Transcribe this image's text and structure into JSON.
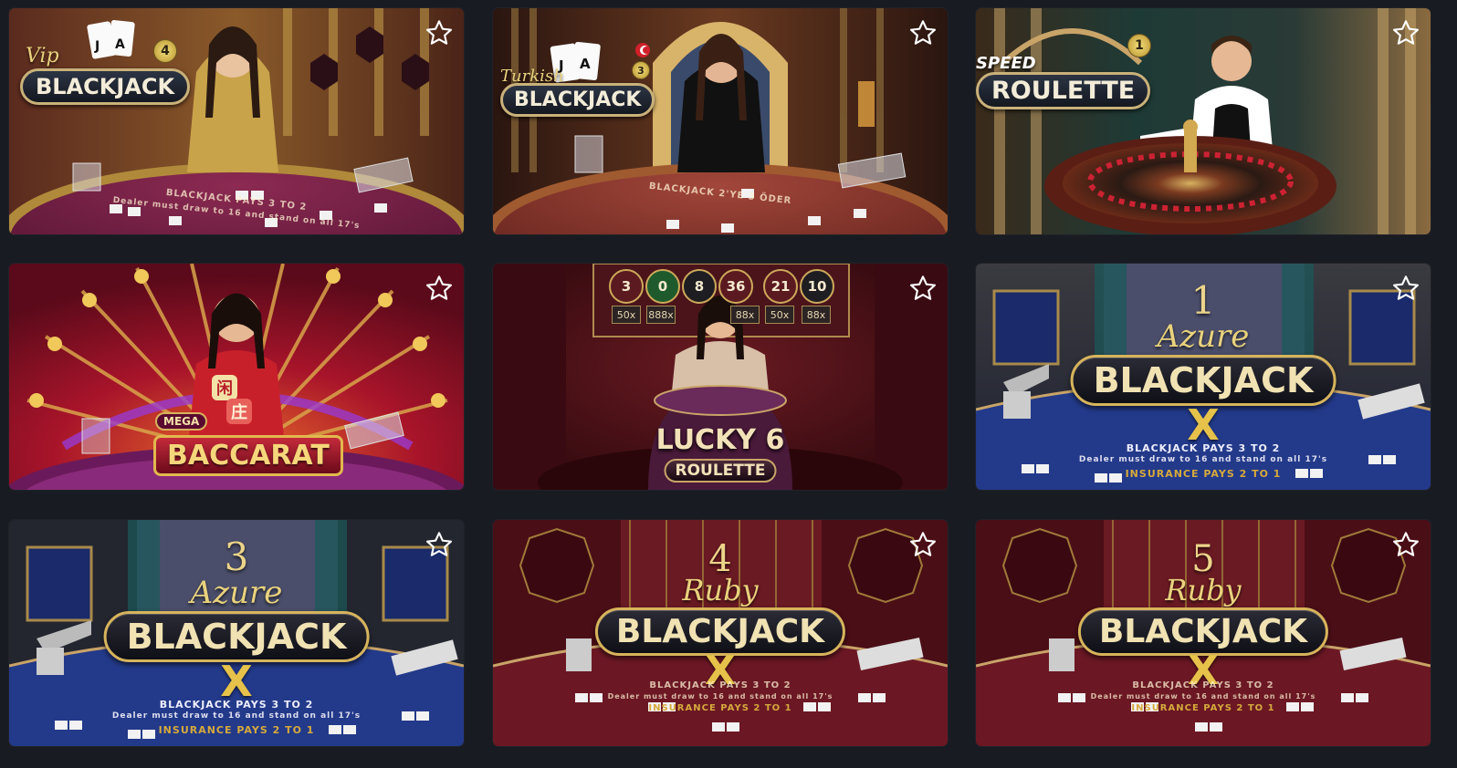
{
  "games": [
    {
      "logo_prefix": "Vip",
      "logo_title": "BLACKJACK",
      "badge": "4"
    },
    {
      "logo_prefix": "Turkish",
      "logo_title": "BLACKJACK",
      "badge": "3"
    },
    {
      "logo_prefix": "SPEED",
      "logo_title": "ROULETTE",
      "badge": "1"
    },
    {
      "logo_prefix": "MEGA",
      "logo_title": "BACCARAT",
      "badge": ""
    },
    {
      "logo_prefix": "LUCKY 6",
      "logo_title": "ROULETTE",
      "badge": ""
    },
    {
      "logo_prefix": "Azure",
      "logo_title": "BLACKJACK",
      "badge": "1"
    },
    {
      "logo_prefix": "Azure",
      "logo_title": "BLACKJACK",
      "badge": "3"
    },
    {
      "logo_prefix": "Ruby",
      "logo_title": "BLACKJACK",
      "badge": "4"
    },
    {
      "logo_prefix": "Ruby",
      "logo_title": "BLACKJACK",
      "badge": "5"
    }
  ],
  "felt": {
    "pays": "BLACKJACK PAYS 3 TO 2",
    "dealer_rule": "Dealer must draw to 16 and stand on all 17's",
    "insurance": "INSURANCE PAYS 2 TO 1",
    "turkish_pays": "BLACKJACK 2'YE 3 ÖDER"
  },
  "lucky6": {
    "numbers": [
      "3",
      "0",
      "8",
      "36",
      "21",
      "10"
    ],
    "multipliers": [
      "50x",
      "888x",
      "",
      "88x",
      "50x",
      "88x"
    ]
  },
  "baccarat_chars": [
    "闲",
    "庄"
  ],
  "colors": {
    "background": "#191b22",
    "gold": "#d7b45c",
    "azure_felt": "#233a8a",
    "ruby_felt": "#6b1824",
    "vip_felt": "#6e1d3e"
  },
  "icons": {
    "favorite": "star-outline-icon"
  }
}
